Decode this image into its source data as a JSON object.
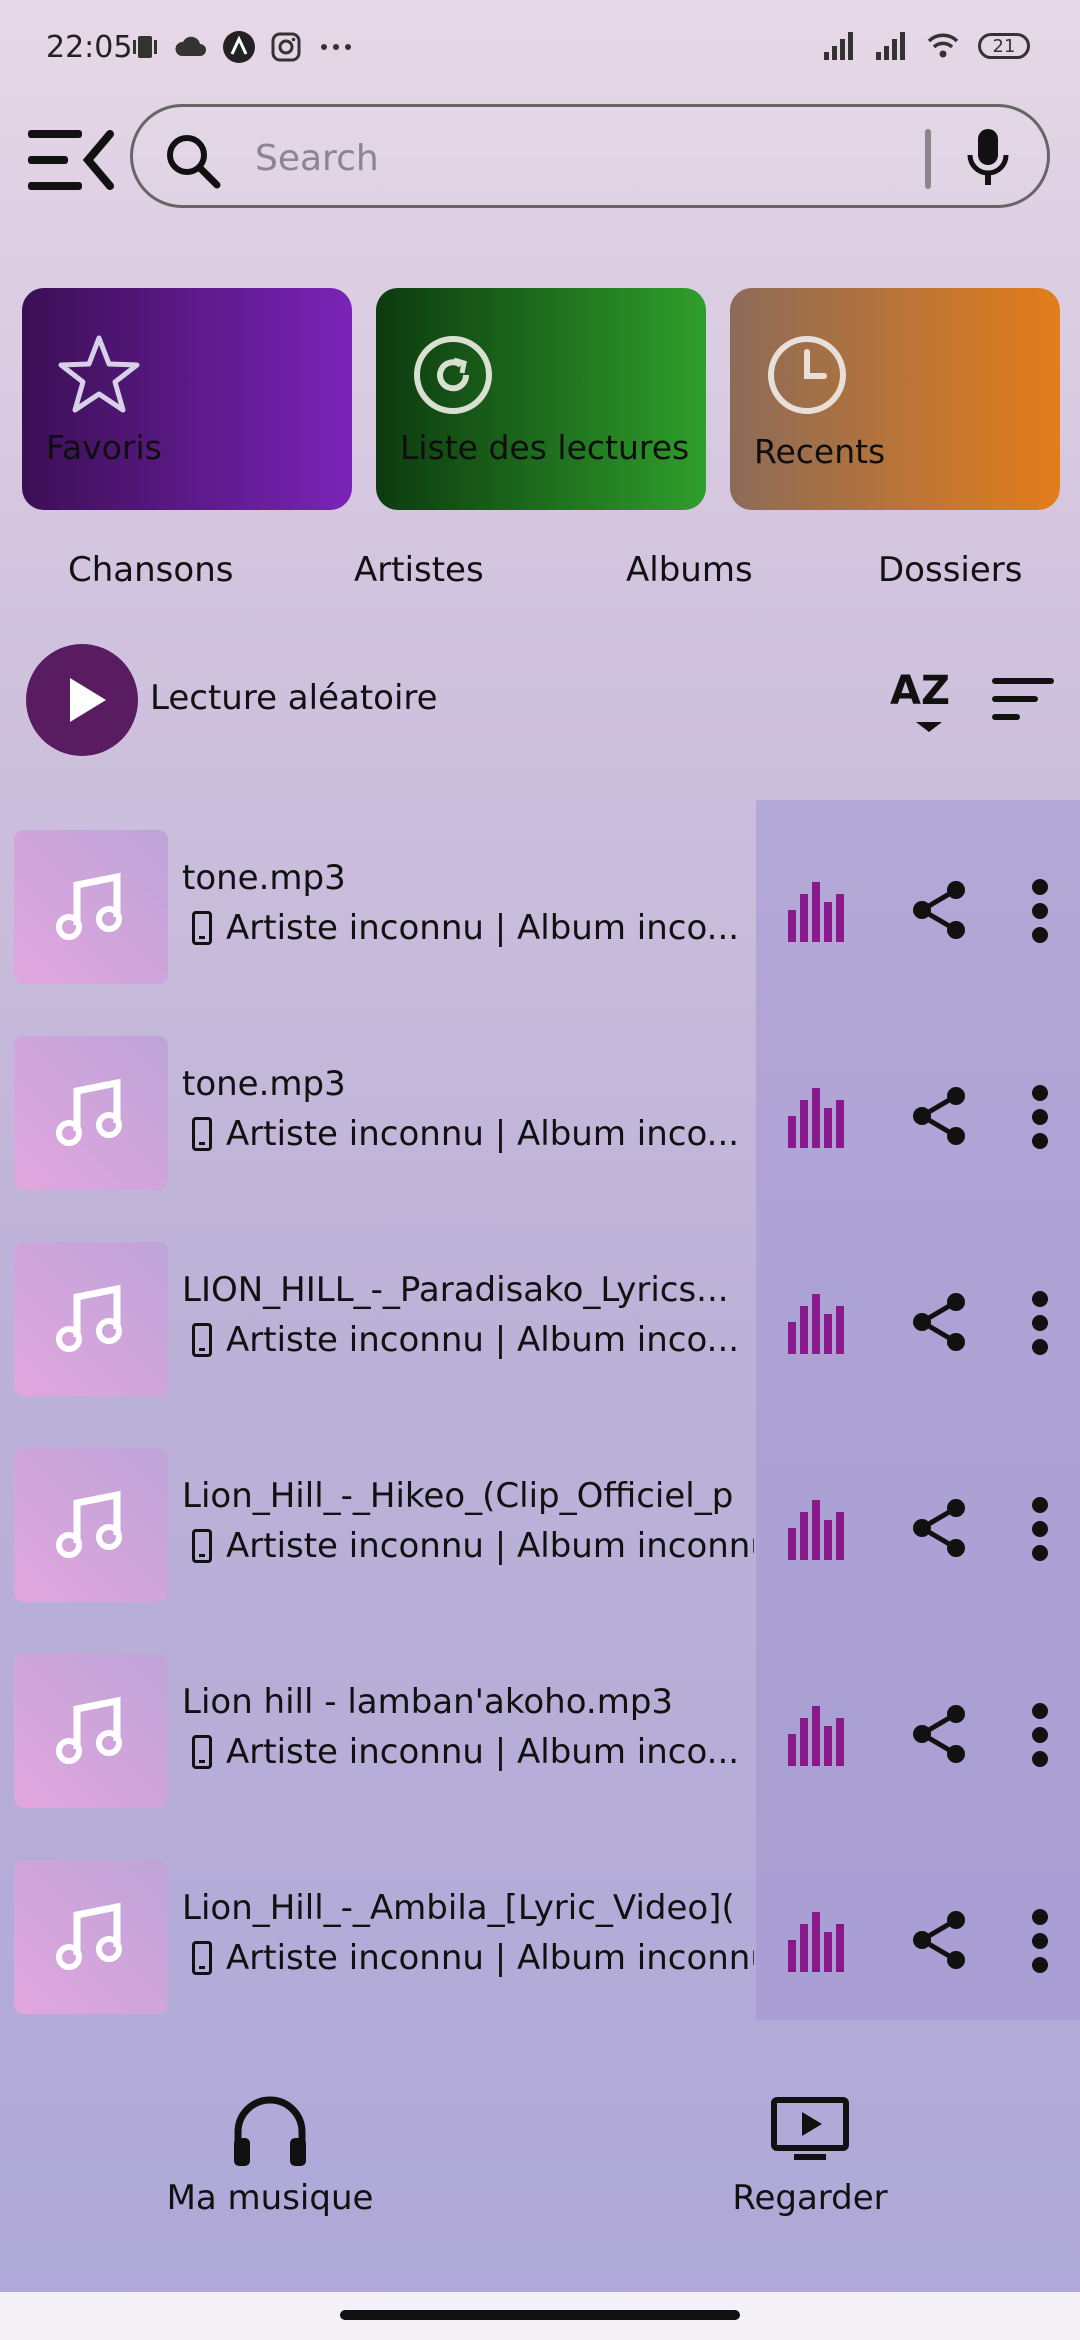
{
  "status": {
    "time": "22:05",
    "battery": "21"
  },
  "search": {
    "placeholder": "Search"
  },
  "cards": [
    {
      "label": "Favoris",
      "icon": "star-icon"
    },
    {
      "label": "Liste des lectures",
      "icon": "replay-icon"
    },
    {
      "label": "Recents",
      "icon": "clock-icon"
    }
  ],
  "tabs": [
    "Chansons",
    "Artistes",
    "Albums",
    "Dossiers"
  ],
  "shuffle": {
    "label": "Lecture aléatoire",
    "sort_az": "AZ"
  },
  "songs": [
    {
      "title": "tone.mp3",
      "meta": "Artiste inconnu | Album inco..."
    },
    {
      "title": "tone.mp3",
      "meta": "Artiste inconnu | Album inco..."
    },
    {
      "title": "LION_HILL_-_Paradisako_Lyrics...",
      "meta": "Artiste inconnu | Album inco..."
    },
    {
      "title": "Lion_Hill_-_Hikeo_(Clip_Officiel_p",
      "meta": "Artiste inconnu | Album inconnu"
    },
    {
      "title": "Lion hill - lamban'akoho.mp3",
      "meta": "Artiste inconnu | Album inco..."
    },
    {
      "title": "Lion_Hill_-_Ambila_[Lyric_Video](",
      "meta": "Artiste inconnu | Album inconnu"
    }
  ],
  "bottom_nav": [
    {
      "label": "Ma musique",
      "icon": "headphones-icon"
    },
    {
      "label": "Regarder",
      "icon": "video-play-icon"
    }
  ],
  "colors": {
    "accent": "#8a1a8c",
    "fav": "#7a24b8",
    "playlist": "#2f9f2b",
    "recent": "#e37d1a"
  }
}
